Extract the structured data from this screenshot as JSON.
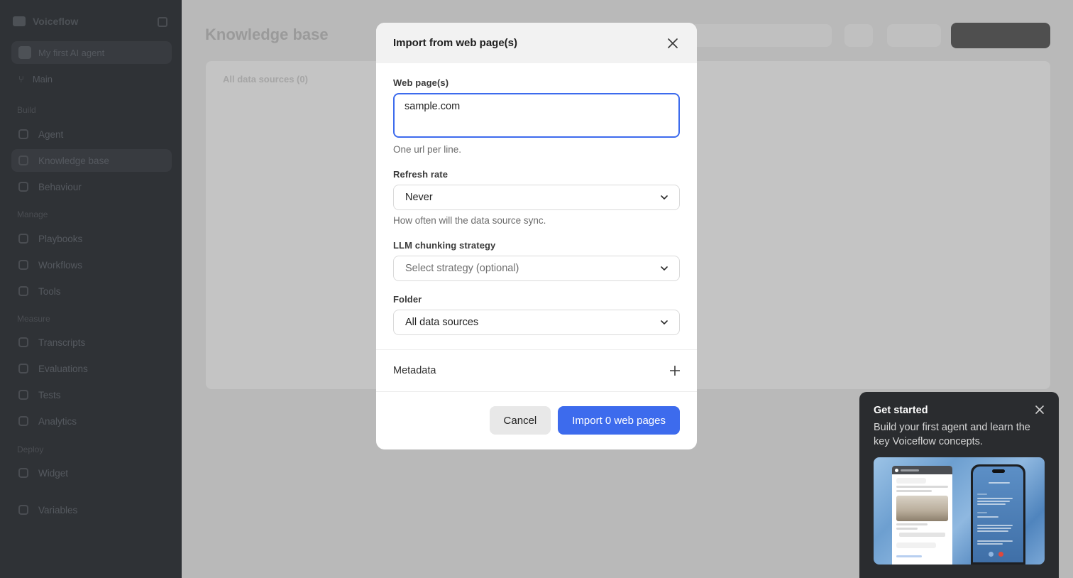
{
  "background": {
    "workspace_name": "Voiceflow",
    "agent_name": "My first AI agent",
    "environment": "Main",
    "page_title": "Knowledge base",
    "card_caption": "All data sources (0)",
    "sidebar_sections": [
      {
        "label": "Build",
        "items": [
          "Agent",
          "Knowledge base",
          "Behaviour"
        ]
      },
      {
        "label": "Manage",
        "items": [
          "Playbooks",
          "Workflows",
          "Tools"
        ]
      },
      {
        "label": "Measure",
        "items": [
          "Transcripts",
          "Evaluations",
          "Tests",
          "Analytics"
        ]
      },
      {
        "label": "Deploy",
        "items": [
          "Widget"
        ]
      }
    ],
    "sidebar_bottom_item": "Variables"
  },
  "modal": {
    "title": "Import from web page(s)",
    "web_pages": {
      "label": "Web page(s)",
      "value": "sample.com",
      "hint": "One url per line."
    },
    "refresh_rate": {
      "label": "Refresh rate",
      "value": "Never",
      "hint": "How often will the data source sync."
    },
    "chunking": {
      "label": "LLM chunking strategy",
      "placeholder": "Select strategy (optional)"
    },
    "folder": {
      "label": "Folder",
      "value": "All data sources"
    },
    "metadata_label": "Metadata",
    "cancel_label": "Cancel",
    "import_label": "Import 0 web pages",
    "accent_color": "#3d6bed"
  },
  "get_started": {
    "title": "Get started",
    "text": "Build your first agent and learn the key Voiceflow concepts."
  },
  "icons": {
    "modal_close": "close-icon",
    "select_chevron": "chevron-down-icon",
    "metadata_add": "plus-icon",
    "popup_close": "close-icon"
  }
}
